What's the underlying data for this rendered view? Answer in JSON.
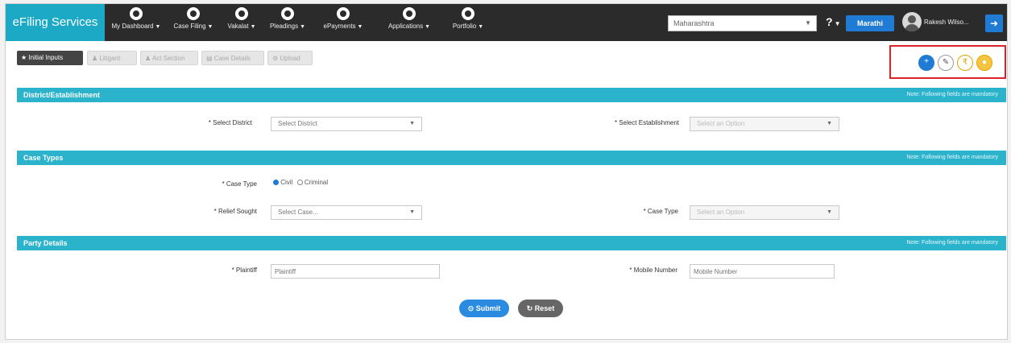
{
  "brand": "eFiling Services",
  "nav": [
    {
      "label": "My Dashboard",
      "icon": "dashboard-icon"
    },
    {
      "label": "Case Filing",
      "icon": "case-filing-icon"
    },
    {
      "label": "Vakalat",
      "icon": "vakalat-icon"
    },
    {
      "label": "Pleadings",
      "icon": "pleadings-icon"
    },
    {
      "label": "ePayments",
      "icon": "epayments-icon"
    },
    {
      "label": "Applications",
      "icon": "applications-icon"
    },
    {
      "label": "Portfolio",
      "icon": "portfolio-icon"
    }
  ],
  "header": {
    "state_select": "Maharashtra",
    "help": "?",
    "language_button": "Marathi",
    "user_name": "Rakesh Wilso..."
  },
  "toolbar": {
    "initial_inputs": "Initial Inputs",
    "litigant": "Litigant",
    "act_section": "Act Section",
    "case_details": "Case Details",
    "upload": "Upload"
  },
  "sections": {
    "district": {
      "title": "District/Establishment",
      "note": "Note: Following fields are mandatory"
    },
    "case_types": {
      "title": "Case Types",
      "note": "Note: Following fields are mandatory"
    },
    "party": {
      "title": "Party Details",
      "note": "Note: Following fields are mandatory"
    }
  },
  "form": {
    "district_label": "* Select District",
    "district_value": "Select District",
    "establishment_label": "* Select Establishment",
    "establishment_value": "Select an Option",
    "case_type_label": "* Case Type",
    "radio_civil": "Civil",
    "radio_criminal": "Criminal",
    "relief_label": "* Relief Sought",
    "relief_value": "Select Case...",
    "case_type2_label": "* Case Type",
    "case_type2_value": "Select an Option",
    "plaintiff_label": "* Plaintiff",
    "plaintiff_placeholder": "Plaintiff",
    "mobile_label": "* Mobile Number",
    "mobile_placeholder": "Mobile Number"
  },
  "actions": {
    "submit": "Submit",
    "reset": "Reset"
  },
  "colors": {
    "brand": "#1ba9c6",
    "section_bar": "#2bb3cc",
    "primary": "#1f7bd3",
    "highlight_box": "#d9252a"
  }
}
